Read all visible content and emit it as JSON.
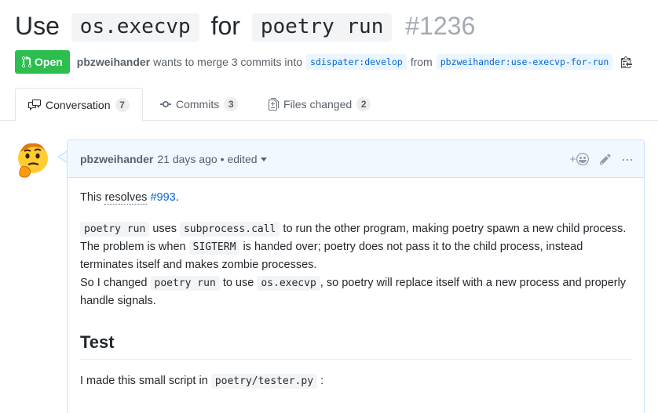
{
  "pr": {
    "title_prefix": "Use",
    "title_code1": "os.execvp",
    "title_mid": "for",
    "title_code2": "poetry run",
    "number": "#1236",
    "state": "Open",
    "author": "pbzweihander",
    "merge_text": "wants to merge 3 commits into",
    "base_branch": "sdispater:develop",
    "from_text": "from",
    "head_branch": "pbzweihander:use-execvp-for-run"
  },
  "tabs": [
    {
      "label": "Conversation",
      "count": "7"
    },
    {
      "label": "Commits",
      "count": "3"
    },
    {
      "label": "Files changed",
      "count": "2"
    }
  ],
  "comment": {
    "author": "pbzweihander",
    "time": "21 days ago",
    "edited": "• edited",
    "add_reaction": "+",
    "p1_text": "This",
    "p1_link_text": "resolves",
    "p1_issue": "#993",
    "p1_end": ".",
    "p2_code1": "poetry run",
    "p2_t1": "uses",
    "p2_code2": "subprocess.call",
    "p2_t2": "to run the other program, making poetry spawn a new child process.",
    "p3_t1": "The problem is when",
    "p3_code": "SIGTERM",
    "p3_t2": "is handed over; poetry does not pass it to the child process, instead terminates itself and makes zombie processes.",
    "p4_t1": "So I changed",
    "p4_code1": "poetry run",
    "p4_t2": "to use",
    "p4_code2": "os.execvp",
    "p4_t3": ", so poetry will replace itself with a new process and properly handle signals.",
    "heading": "Test",
    "p5_t1": "I made this small script in",
    "p5_code": "poetry/tester.py",
    "p5_t2": ":"
  },
  "colors": {
    "open_green": "#2cbe4e",
    "link_blue": "#0366d6",
    "comment_border": "#c8e1ff",
    "comment_header_bg": "#f1f8ff"
  }
}
